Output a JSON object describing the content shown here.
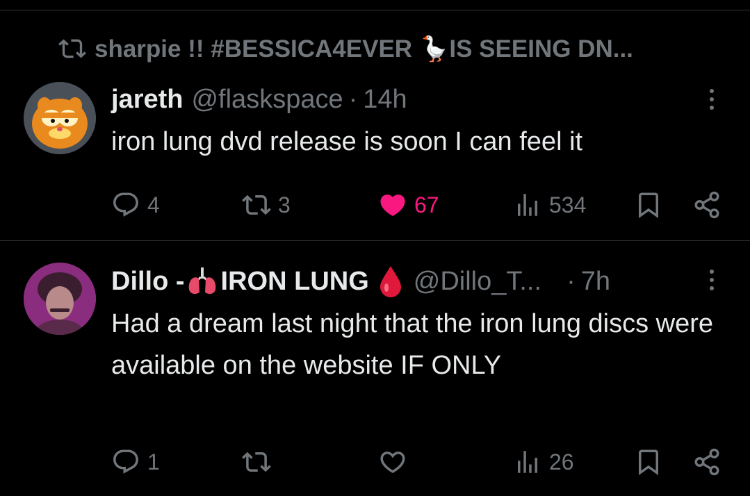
{
  "repost_context": {
    "text": "sharpie !! #BESSICA4EVER 🪿IS SEEING DN..."
  },
  "posts": [
    {
      "display_name": "jareth",
      "handle": "@flaskspace",
      "separator": "·",
      "time": "14h",
      "text": "iron lung dvd release is soon I can feel it",
      "actions": {
        "replies": "4",
        "reposts": "3",
        "likes": "67",
        "views": "534"
      },
      "liked": true
    },
    {
      "display_name_prefix": "Dillo -",
      "display_name_suffix": "IRON LUNG",
      "handle": "@Dillo_T...",
      "separator": "·",
      "time": "7h",
      "text": "Had a dream last night that the iron lung discs were available on the website IF ONLY",
      "actions": {
        "replies": "1",
        "reposts": "",
        "likes": "",
        "views": "26"
      },
      "liked": false
    }
  ],
  "icons": {
    "reply": "reply-icon",
    "repost": "repost-icon",
    "like": "heart-icon",
    "views": "views-icon",
    "bookmark": "bookmark-icon",
    "share": "share-icon",
    "more": "more-icon"
  },
  "colors": {
    "background": "#000000",
    "text": "#e7e9ea",
    "muted": "#71767b",
    "like": "#f91880",
    "divider": "#2f3336"
  }
}
